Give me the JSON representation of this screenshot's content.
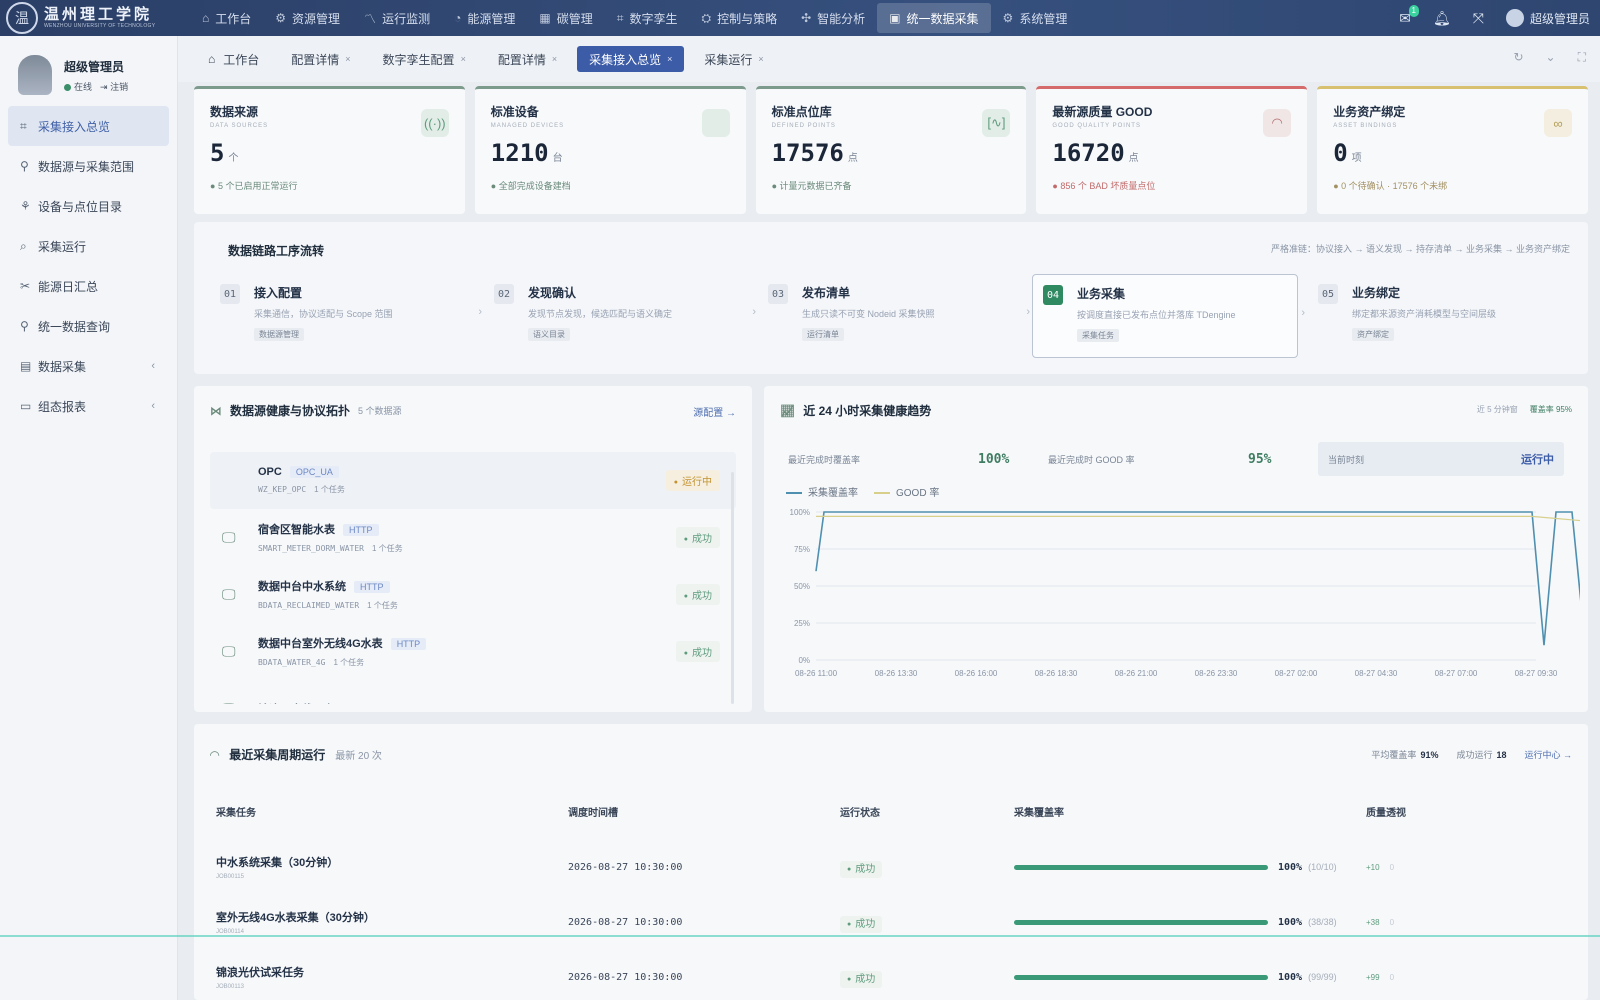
{
  "brand": {
    "name_cn": "温州理工学院",
    "name_en": "WENZHOU UNIVERSITY OF TECHNOLOGY",
    "logo_char": "温"
  },
  "topnav": [
    {
      "label": "工作台",
      "icon": "⌂"
    },
    {
      "label": "资源管理",
      "icon": "⚙"
    },
    {
      "label": "运行监测",
      "icon": "〽"
    },
    {
      "label": "能源管理",
      "icon": "◔"
    },
    {
      "label": "碳管理",
      "icon": "▦"
    },
    {
      "label": "数字孪生",
      "icon": "⌗"
    },
    {
      "label": "控制与策略",
      "icon": "⛭"
    },
    {
      "label": "智能分析",
      "icon": "✣"
    },
    {
      "label": "统一数据采集",
      "icon": "▣",
      "active": true
    },
    {
      "label": "系统管理",
      "icon": "⚙"
    }
  ],
  "topright": {
    "badge": "1",
    "user": "超级管理员"
  },
  "profile": {
    "name": "超级管理员",
    "online": "在线",
    "logout": "注销"
  },
  "menu": [
    {
      "label": "采集接入总览",
      "icon": "⌗",
      "active": true
    },
    {
      "label": "数据源与采集范围",
      "icon": "⚲"
    },
    {
      "label": "设备与点位目录",
      "icon": "⚘"
    },
    {
      "label": "采集运行",
      "icon": "⌕"
    },
    {
      "label": "能源日汇总",
      "icon": "✂"
    },
    {
      "label": "统一数据查询",
      "icon": "⚲"
    },
    {
      "label": "数据采集",
      "icon": "▤",
      "chev": "‹"
    },
    {
      "label": "组态报表",
      "icon": "▭",
      "chev": "‹"
    }
  ],
  "tabs": [
    {
      "label": "工作台",
      "home": true
    },
    {
      "label": "配置详情",
      "close": "×"
    },
    {
      "label": "数字孪生配置",
      "close": "×"
    },
    {
      "label": "配置详情",
      "close": "×"
    },
    {
      "label": "采集接入总览",
      "close": "×",
      "active": true
    },
    {
      "label": "采集运行",
      "close": "×"
    }
  ],
  "stats": [
    {
      "title": "数据来源",
      "sub": "DATA SOURCES",
      "value": "5",
      "unit": "个",
      "note": "5 个已启用正常运行",
      "icon": "((·))",
      "color": "green"
    },
    {
      "title": "标准设备",
      "sub": "MANAGED DEVICES",
      "value": "1210",
      "unit": "台",
      "note": "全部完成设备建档",
      "icon": "",
      "color": "green"
    },
    {
      "title": "标准点位库",
      "sub": "DEFINED POINTS",
      "value": "17576",
      "unit": "点",
      "note": "计量元数据已齐备",
      "icon": "[∿]",
      "color": "green"
    },
    {
      "title": "最新源质量 GOOD",
      "sub": "GOOD QUALITY POINTS",
      "value": "16720",
      "unit": "点",
      "note": "856 个 BAD 坏质量点位",
      "icon": "◠",
      "color": "red"
    },
    {
      "title": "业务资产绑定",
      "sub": "ASSET BINDINGS",
      "value": "0",
      "unit": "项",
      "note": "0 个待确认 · 17576 个未绑",
      "icon": "∞",
      "color": "yellow"
    }
  ],
  "flow": {
    "title": "数据链路工序流转",
    "rule": "严格准链：协议接入 → 语义发现 → 持存清单 → 业务采集 → 业务资产绑定",
    "steps": [
      {
        "num": "01",
        "name": "接入配置",
        "desc": "采集通信，协议适配与 Scope 范围",
        "tag": "数据源管理"
      },
      {
        "num": "02",
        "name": "发现确认",
        "desc": "发现节点发现，候选匹配与语义确定",
        "tag": "语义目录"
      },
      {
        "num": "03",
        "name": "发布清单",
        "desc": "生成只读不可变 Nodeid 采集快照",
        "tag": "运行清单"
      },
      {
        "num": "04",
        "name": "业务采集",
        "desc": "按调度直接已发布点位并落库 TDengine",
        "tag": "采集任务",
        "active": true
      },
      {
        "num": "05",
        "name": "业务绑定",
        "desc": "绑定都来源资产消耗模型与空间层级",
        "tag": "资产绑定"
      }
    ]
  },
  "sources_panel": {
    "title": "数据源健康与协议拓扑",
    "count": "5 个数据源",
    "link": "源配置 →",
    "items": [
      {
        "name": "OPC",
        "proto": "OPC_UA",
        "code": "WZ_KEP_OPC",
        "tasks": "1 个任务",
        "status": "运行中",
        "running": true
      },
      {
        "name": "宿舍区智能水表",
        "proto": "HTTP",
        "code": "SMART_METER_DORM_WATER",
        "tasks": "1 个任务",
        "status": "成功"
      },
      {
        "name": "数据中台中水系统",
        "proto": "HTTP",
        "code": "BDATA_RECLAIMED_WATER",
        "tasks": "1 个任务",
        "status": "成功"
      },
      {
        "name": "数据中台室外无线4G水表",
        "proto": "HTTP",
        "code": "BDATA_WATER_4G",
        "tasks": "1 个任务",
        "status": "成功"
      },
      {
        "name": "锦浪云光伏平台",
        "proto": "HTTP",
        "code": "",
        "tasks": "",
        "status": ""
      }
    ]
  },
  "trend_panel": {
    "title": "近 24 小时采集健康趋势",
    "legend_right_a": "近 5 分钟窗",
    "legend_right_b": "覆盖率 95%",
    "m1_label": "最近完成时覆盖率",
    "m1_value": "100%",
    "m2_label": "最近完成时 GOOD 率",
    "m2_value": "95%",
    "box_label": "当前时刻",
    "box_value": "运行中",
    "series_a": "采集覆盖率",
    "series_b": "GOOD 率"
  },
  "chart_data": {
    "type": "line",
    "x": [
      "08-26 11:00",
      "08-26 13:30",
      "08-26 16:00",
      "08-26 18:30",
      "08-26 21:00",
      "08-26 23:30",
      "08-27 02:00",
      "08-27 04:30",
      "08-27 07:00",
      "08-27 09:30"
    ],
    "yticks": [
      "100%",
      "75%",
      "50%",
      "25%",
      "0%"
    ],
    "ylim": [
      0,
      100
    ],
    "series": [
      {
        "name": "采集覆盖率",
        "color": "#4f8fb0",
        "points": [
          [
            0,
            60
          ],
          [
            0.1,
            100
          ],
          [
            1,
            100
          ],
          [
            2,
            100
          ],
          [
            3,
            100
          ],
          [
            4,
            100
          ],
          [
            5,
            100
          ],
          [
            6,
            100
          ],
          [
            7,
            100
          ],
          [
            8,
            100
          ],
          [
            8.95,
            100
          ],
          [
            9.1,
            10
          ],
          [
            9.25,
            100
          ],
          [
            9.45,
            100
          ],
          [
            9.6,
            18
          ]
        ]
      },
      {
        "name": "GOOD 率",
        "color": "#d7cf8a",
        "points": [
          [
            0,
            97
          ],
          [
            1,
            97
          ],
          [
            2,
            97
          ],
          [
            3,
            97
          ],
          [
            4,
            97
          ],
          [
            5,
            97
          ],
          [
            6,
            97
          ],
          [
            7,
            97
          ],
          [
            8,
            97
          ],
          [
            8.95,
            97
          ],
          [
            9.6,
            94
          ]
        ]
      }
    ]
  },
  "runs_panel": {
    "title": "最近采集周期运行",
    "count": "最新 20 次",
    "avg_label": "平均覆盖率",
    "avg_value": "91%",
    "success_label": "成功运行",
    "success_value": "18",
    "link": "运行中心 →",
    "headers": [
      "采集任务",
      "调度时间槽",
      "运行状态",
      "采集覆盖率",
      "质量透视"
    ],
    "rows": [
      {
        "name": "中水系统采集（30分钟）",
        "sub": "JOB00115",
        "time": "2026-08-27 10:30:00",
        "status": "成功",
        "pct": "100%",
        "coverage": 1.0,
        "frac": "(10/10)",
        "good": "+10",
        "bad": "0"
      },
      {
        "name": "室外无线4G水表采集（30分钟）",
        "sub": "JOB00114",
        "time": "2026-08-27 10:30:00",
        "status": "成功",
        "pct": "100%",
        "coverage": 1.0,
        "frac": "(38/38)",
        "good": "+38",
        "bad": "0"
      },
      {
        "name": "锦浪光伏试采任务",
        "sub": "JOB00113",
        "time": "2026-08-27 10:30:00",
        "status": "成功",
        "pct": "100%",
        "coverage": 1.0,
        "frac": "(99/99)",
        "good": "+99",
        "bad": "0"
      }
    ]
  }
}
